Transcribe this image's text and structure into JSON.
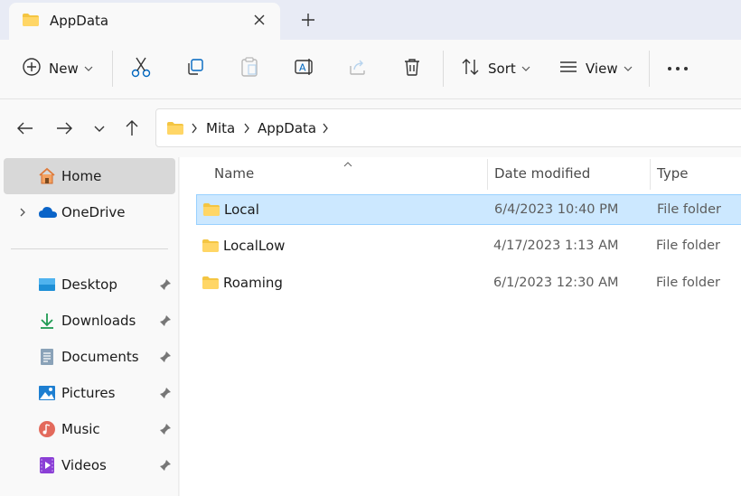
{
  "window": {
    "tab_title": "AppData"
  },
  "toolbar": {
    "new_label": "New",
    "sort_label": "Sort",
    "view_label": "View"
  },
  "breadcrumb": {
    "items": [
      "Mita",
      "AppData"
    ]
  },
  "sidebar": {
    "home": "Home",
    "onedrive": "OneDrive",
    "items": [
      {
        "label": "Desktop",
        "icon": "desktop-icon"
      },
      {
        "label": "Downloads",
        "icon": "download-icon"
      },
      {
        "label": "Documents",
        "icon": "document-icon"
      },
      {
        "label": "Pictures",
        "icon": "picture-icon"
      },
      {
        "label": "Music",
        "icon": "music-icon"
      },
      {
        "label": "Videos",
        "icon": "video-icon"
      }
    ]
  },
  "columns": {
    "name": "Name",
    "date": "Date modified",
    "type": "Type"
  },
  "rows": [
    {
      "name": "Local",
      "date": "6/4/2023 10:40 PM",
      "type": "File folder",
      "selected": true
    },
    {
      "name": "LocalLow",
      "date": "4/17/2023 1:13 AM",
      "type": "File folder",
      "selected": false
    },
    {
      "name": "Roaming",
      "date": "6/1/2023 12:30 AM",
      "type": "File folder",
      "selected": false
    }
  ],
  "colors": {
    "accent": "#0067c0",
    "folder": "#f4c542",
    "selection": "#cce8ff"
  }
}
